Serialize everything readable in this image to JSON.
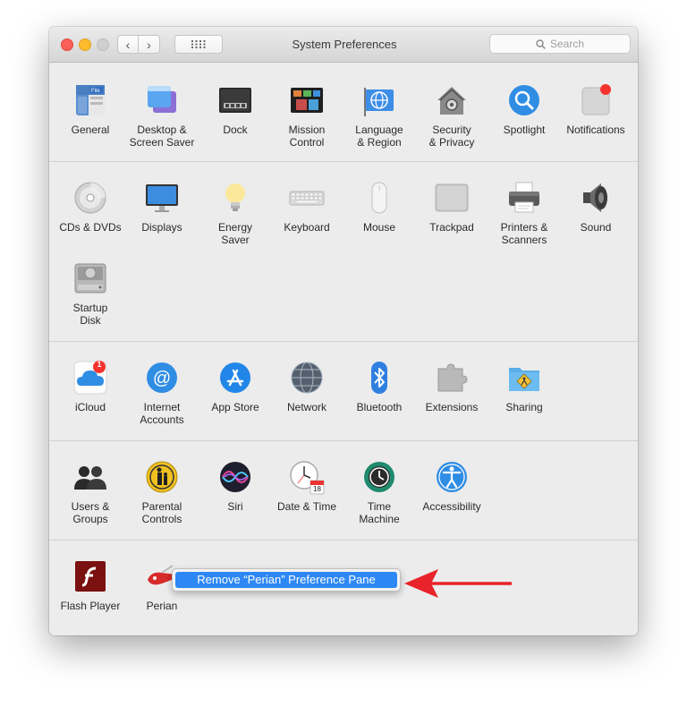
{
  "window": {
    "title": "System Preferences",
    "search_placeholder": "Search"
  },
  "sections": [
    {
      "items": [
        {
          "label": "General",
          "icon": "general-icon"
        },
        {
          "label": "Desktop &\nScreen Saver",
          "icon": "desktop-screen-saver-icon"
        },
        {
          "label": "Dock",
          "icon": "dock-icon"
        },
        {
          "label": "Mission\nControl",
          "icon": "mission-control-icon"
        },
        {
          "label": "Language\n& Region",
          "icon": "language-region-icon"
        },
        {
          "label": "Security\n& Privacy",
          "icon": "security-privacy-icon"
        },
        {
          "label": "Spotlight",
          "icon": "spotlight-icon"
        },
        {
          "label": "Notifications",
          "icon": "notifications-icon"
        }
      ]
    },
    {
      "items": [
        {
          "label": "CDs & DVDs",
          "icon": "cd-dvd-icon"
        },
        {
          "label": "Displays",
          "icon": "displays-icon"
        },
        {
          "label": "Energy\nSaver",
          "icon": "energy-saver-icon"
        },
        {
          "label": "Keyboard",
          "icon": "keyboard-icon"
        },
        {
          "label": "Mouse",
          "icon": "mouse-icon"
        },
        {
          "label": "Trackpad",
          "icon": "trackpad-icon"
        },
        {
          "label": "Printers &\nScanners",
          "icon": "printer-icon"
        },
        {
          "label": "Sound",
          "icon": "speaker-icon"
        },
        {
          "label": "Startup\nDisk",
          "icon": "startup-disk-icon"
        }
      ]
    },
    {
      "items": [
        {
          "label": "iCloud",
          "icon": "icloud-icon",
          "badge": "1"
        },
        {
          "label": "Internet\nAccounts",
          "icon": "internet-accounts-icon"
        },
        {
          "label": "App Store",
          "icon": "app-store-icon"
        },
        {
          "label": "Network",
          "icon": "network-icon"
        },
        {
          "label": "Bluetooth",
          "icon": "bluetooth-icon"
        },
        {
          "label": "Extensions",
          "icon": "extensions-icon"
        },
        {
          "label": "Sharing",
          "icon": "sharing-icon"
        }
      ]
    },
    {
      "items": [
        {
          "label": "Users &\nGroups",
          "icon": "users-groups-icon"
        },
        {
          "label": "Parental\nControls",
          "icon": "parental-controls-icon"
        },
        {
          "label": "Siri",
          "icon": "siri-icon"
        },
        {
          "label": "Date & Time",
          "icon": "date-time-icon",
          "date_text": "18"
        },
        {
          "label": "Time\nMachine",
          "icon": "time-machine-icon"
        },
        {
          "label": "Accessibility",
          "icon": "accessibility-icon"
        }
      ]
    },
    {
      "items": [
        {
          "label": "Flash Player",
          "icon": "flash-player-icon"
        },
        {
          "label": "Perian",
          "icon": "perian-icon"
        }
      ]
    }
  ],
  "context_menu": {
    "item": "Remove “Perian” Preference Pane"
  },
  "colors": {
    "accent": "#2d88f5",
    "arrow": "#e8232a"
  }
}
